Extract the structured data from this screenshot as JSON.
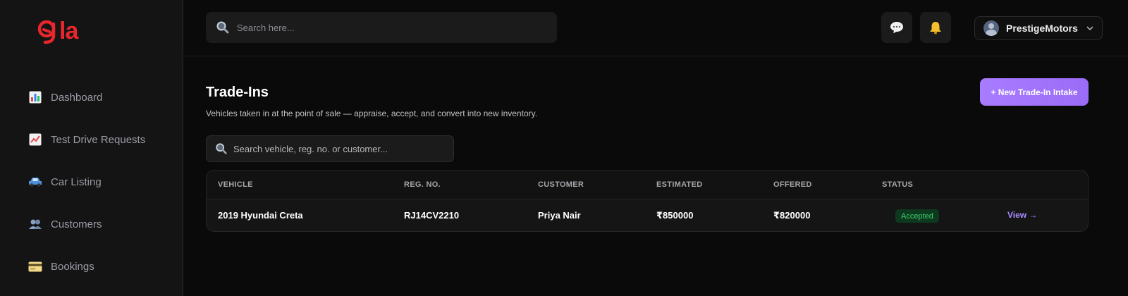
{
  "brand": {
    "logo_text": "la",
    "accent": "#e8262c"
  },
  "sidebar": {
    "items": [
      {
        "label": "Dashboard",
        "icon": "bar-chart-icon"
      },
      {
        "label": "Test Drive Requests",
        "icon": "line-chart-icon"
      },
      {
        "label": "Car Listing",
        "icon": "car-icon"
      },
      {
        "label": "Customers",
        "icon": "users-icon"
      },
      {
        "label": "Bookings",
        "icon": "credit-card-icon"
      }
    ]
  },
  "topbar": {
    "search_placeholder": "Search here...",
    "user_name": "PrestigeMotors"
  },
  "page": {
    "title": "Trade-Ins",
    "subtitle": "Vehicles taken in at the point of sale — appraise, accept, and convert into new inventory.",
    "new_button": "+ New Trade-In Intake",
    "table_search_placeholder": "Search vehicle, reg. no. or customer..."
  },
  "table": {
    "headers": [
      "VEHICLE",
      "REG. NO.",
      "CUSTOMER",
      "ESTIMATED",
      "OFFERED",
      "STATUS"
    ],
    "rows": [
      {
        "vehicle": "2019 Hyundai Creta",
        "reg_no": "RJ14CV2210",
        "customer": "Priya Nair",
        "estimated": "₹850000",
        "offered": "₹820000",
        "status": "Accepted",
        "action": "View →"
      }
    ]
  },
  "colors": {
    "primary_button": "#a87cff",
    "status_accepted_bg": "#0d3a1e",
    "status_accepted_text": "#3fcf6e",
    "link": "#a88bff"
  }
}
